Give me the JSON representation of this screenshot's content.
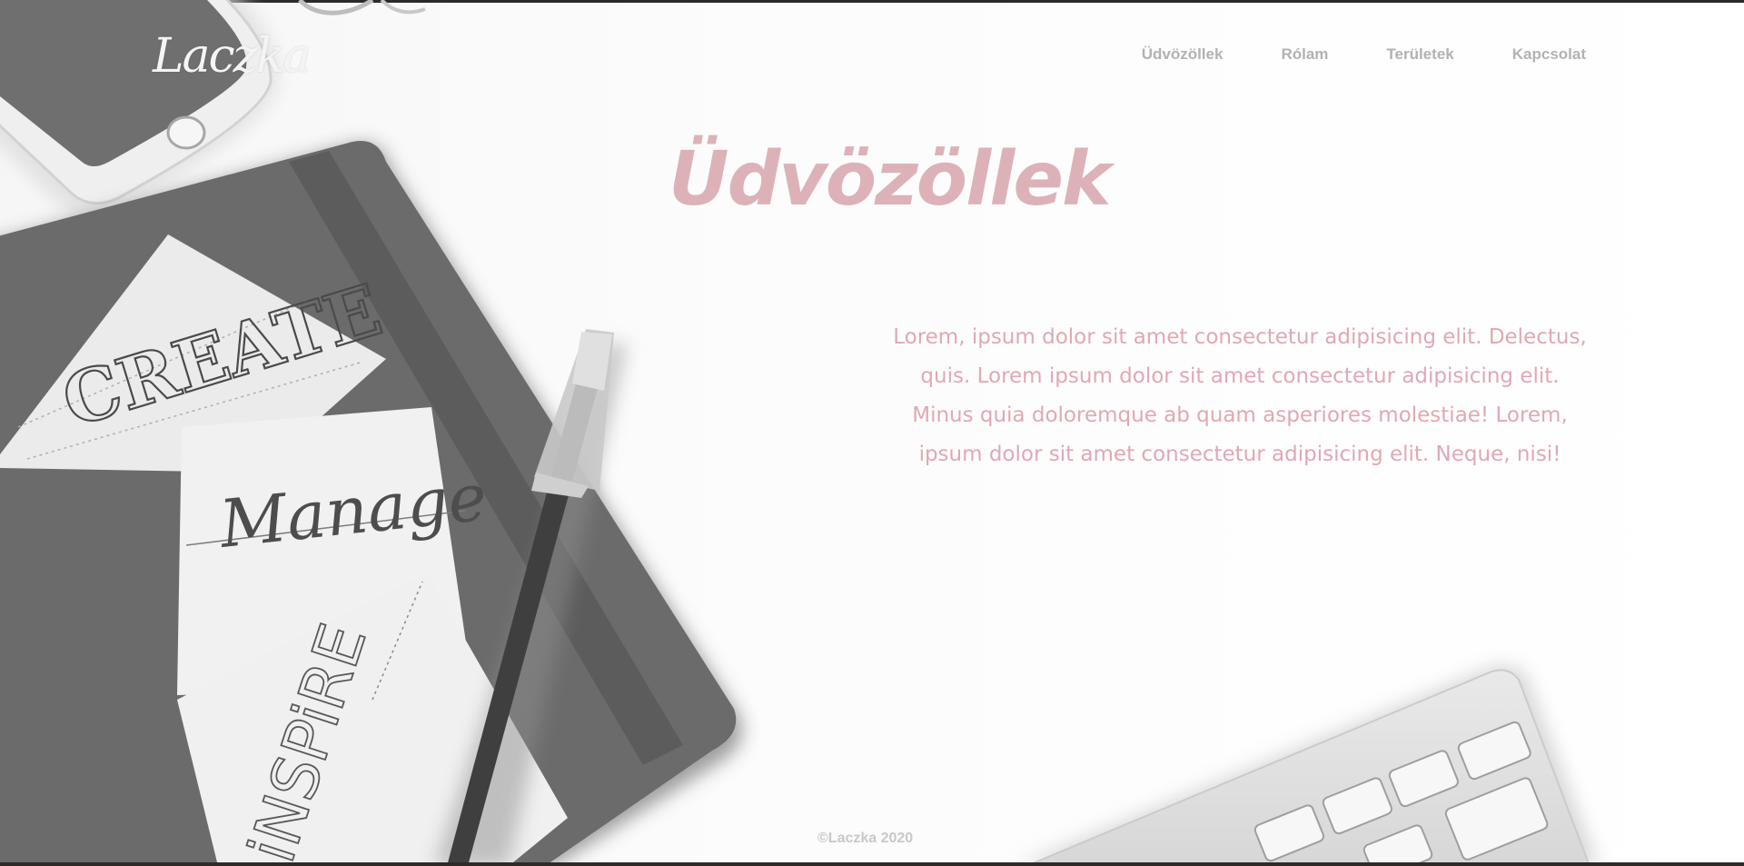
{
  "header": {
    "logo": "Laczka"
  },
  "nav": {
    "items": [
      {
        "label": "Üdvözöllek"
      },
      {
        "label": "Rólam"
      },
      {
        "label": "Területek"
      },
      {
        "label": "Kapcsolat"
      }
    ]
  },
  "hero": {
    "title": "Üdvözöllek",
    "lines": [
      "Lorem, ipsum dolor sit amet consectetur adipisicing elit. Delectus,",
      "quis. Lorem ipsum dolor sit amet consectetur adipisicing elit.",
      "Minus quia doloremque ab quam asperiores molestiae! Lorem,",
      "ipsum dolor sit amet consectetur adipisicing elit. Neque, nisi!"
    ]
  },
  "photo": {
    "note_words": [
      "CREATE",
      "Manage",
      "iNSPiRE"
    ]
  },
  "footer": {
    "copyright": "©Laczka 2020"
  },
  "colors": {
    "title": "#dcb2b8",
    "body_text": "#e1a8b3",
    "nav": "#b2b2b2",
    "logo": "#f4f4f4"
  }
}
